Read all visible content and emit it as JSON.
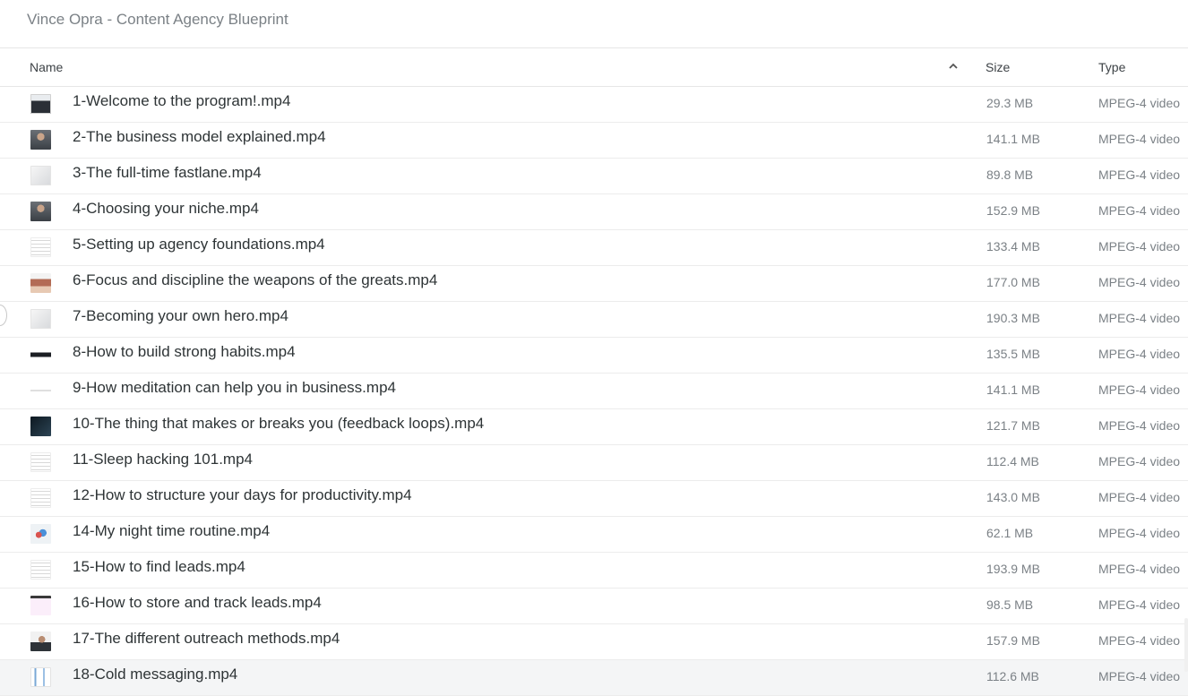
{
  "title": "Vince Opra - Content Agency Blueprint",
  "columns": {
    "name": "Name",
    "size": "Size",
    "type": "Type"
  },
  "sort": {
    "column": "name",
    "direction": "ascending",
    "icon": "chevron-up-icon"
  },
  "files": [
    {
      "name": "1-Welcome to the program!.mp4",
      "size": "29.3 MB",
      "type": "MPEG-4 video",
      "thumb": "person-dark"
    },
    {
      "name": "2-The business model explained.mp4",
      "size": "141.1 MB",
      "type": "MPEG-4 video",
      "thumb": "person-grey"
    },
    {
      "name": "3-The full-time fastlane.mp4",
      "size": "89.8 MB",
      "type": "MPEG-4 video",
      "thumb": "light-graphic"
    },
    {
      "name": "4-Choosing your niche.mp4",
      "size": "152.9 MB",
      "type": "MPEG-4 video",
      "thumb": "person-grey"
    },
    {
      "name": "5-Setting up agency foundations.mp4",
      "size": "133.4 MB",
      "type": "MPEG-4 video",
      "thumb": "doc-lines"
    },
    {
      "name": "6-Focus and discipline the weapons of the greats.mp4",
      "size": "177.0 MB",
      "type": "MPEG-4 video",
      "thumb": "photo-warm"
    },
    {
      "name": "7-Becoming your own hero.mp4",
      "size": "190.3 MB",
      "type": "MPEG-4 video",
      "thumb": "light-graphic"
    },
    {
      "name": "8-How to build strong habits.mp4",
      "size": "135.5 MB",
      "type": "MPEG-4 video",
      "thumb": "dark-text-banner"
    },
    {
      "name": "9-How meditation can help you in business.mp4",
      "size": "141.1 MB",
      "type": "MPEG-4 video",
      "thumb": "blank-line"
    },
    {
      "name": "10-The thing that makes or breaks you (feedback loops).mp4",
      "size": "121.7 MB",
      "type": "MPEG-4 video",
      "thumb": "dark-screen"
    },
    {
      "name": "11-Sleep hacking 101.mp4",
      "size": "112.4 MB",
      "type": "MPEG-4 video",
      "thumb": "doc-lines"
    },
    {
      "name": "12-How to structure your days for productivity.mp4",
      "size": "143.0 MB",
      "type": "MPEG-4 video",
      "thumb": "doc-lines"
    },
    {
      "name": "14-My night time routine.mp4",
      "size": "62.1 MB",
      "type": "MPEG-4 video",
      "thumb": "colorful-map"
    },
    {
      "name": "15-How to find leads.mp4",
      "size": "193.9 MB",
      "type": "MPEG-4 video",
      "thumb": "doc-lines"
    },
    {
      "name": "16-How to store and track leads.mp4",
      "size": "98.5 MB",
      "type": "MPEG-4 video",
      "thumb": "spreadsheet-pink"
    },
    {
      "name": "17-The different outreach methods.mp4",
      "size": "157.9 MB",
      "type": "MPEG-4 video",
      "thumb": "person-light"
    },
    {
      "name": "18-Cold messaging.mp4",
      "size": "112.6 MB",
      "type": "MPEG-4 video",
      "thumb": "diagram-blue"
    }
  ]
}
